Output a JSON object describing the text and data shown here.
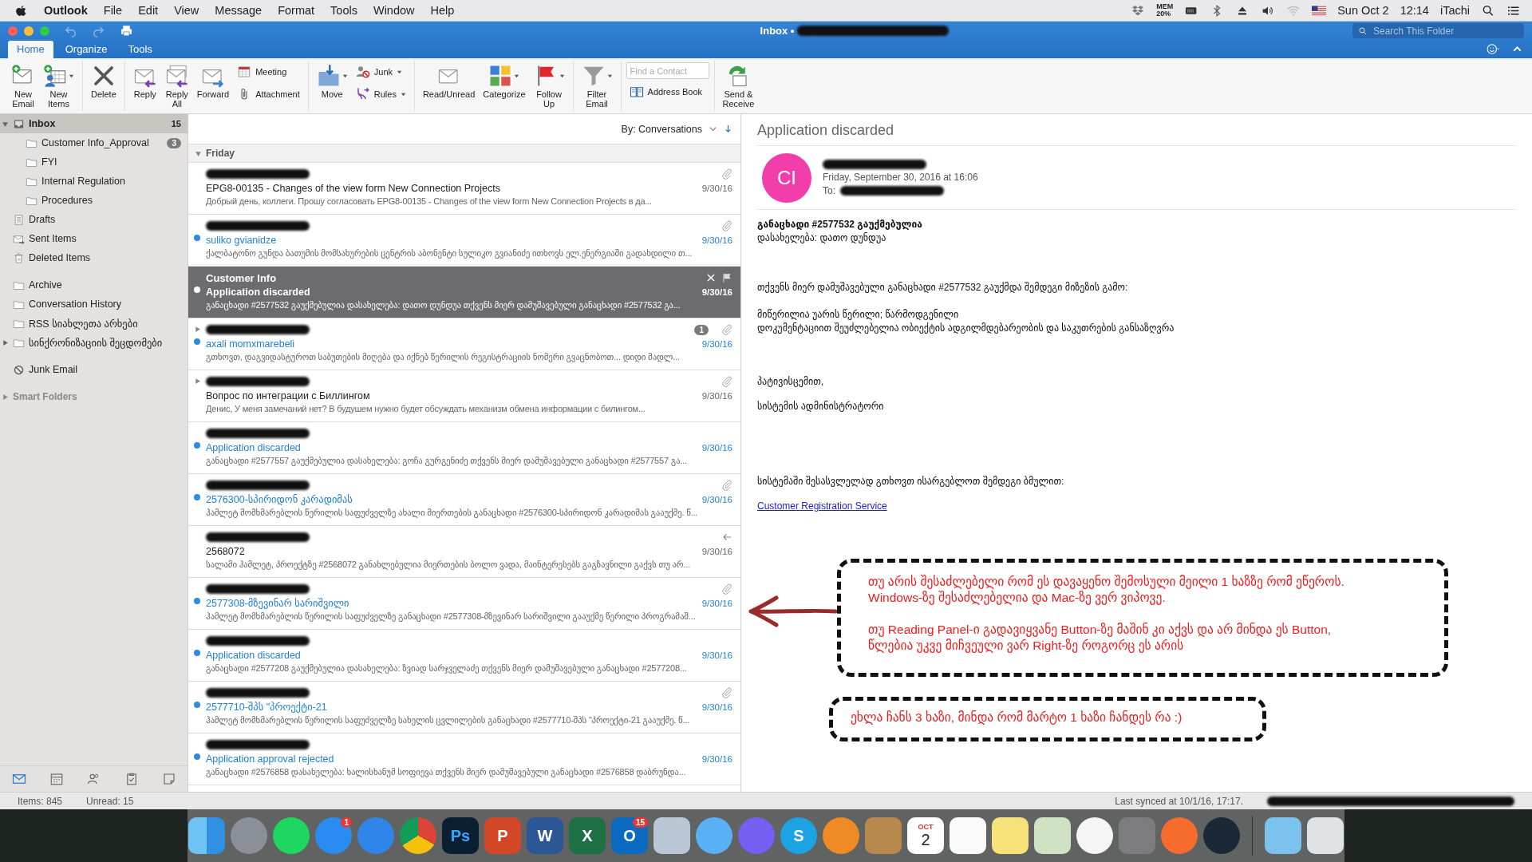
{
  "menubar": {
    "menus": [
      {
        "label": "Outlook",
        "kind": "app"
      },
      {
        "label": "File",
        "kind": "menu"
      },
      {
        "label": "Edit",
        "kind": "menu"
      },
      {
        "label": "View",
        "kind": "menu"
      },
      {
        "label": "Message",
        "kind": "menu"
      },
      {
        "label": "Format",
        "kind": "menu"
      },
      {
        "label": "Tools",
        "kind": "menu"
      },
      {
        "label": "Window",
        "kind": "menu"
      },
      {
        "label": "Help",
        "kind": "menu"
      }
    ],
    "mem_label": "MEM",
    "mem_value": "20%",
    "date": "Sun Oct 2",
    "time": "12:14",
    "user": "iTachi"
  },
  "window": {
    "title": "Inbox •",
    "account_redacted": true,
    "search": {
      "placeholder": "Search This Folder"
    }
  },
  "tabs": [
    {
      "label": "Home",
      "selected": true
    },
    {
      "label": "Organize",
      "selected": false
    },
    {
      "label": "Tools",
      "selected": false
    }
  ],
  "ribbon": {
    "groups": [
      {
        "items": [
          {
            "kind": "new-email",
            "lines": [
              "New",
              "Email"
            ],
            "dropdown": false
          },
          {
            "kind": "new-items",
            "lines": [
              "New",
              "Items"
            ],
            "dropdown": true
          }
        ]
      },
      {
        "items": [
          {
            "kind": "delete",
            "lines": [
              "Delete"
            ],
            "dropdown": false
          }
        ]
      },
      {
        "items": [
          {
            "kind": "reply",
            "lines": [
              "Reply"
            ],
            "dropdown": false
          },
          {
            "kind": "reply-all",
            "lines": [
              "Reply",
              "All"
            ],
            "dropdown": false
          },
          {
            "kind": "forward",
            "lines": [
              "Forward"
            ],
            "dropdown": false
          },
          {
            "stack": [
              {
                "kind": "meeting",
                "label": "Meeting",
                "dropdown": false
              },
              {
                "kind": "attachment",
                "label": "Attachment",
                "dropdown": false
              }
            ]
          }
        ]
      },
      {
        "items": [
          {
            "kind": "move",
            "lines": [
              "Move"
            ],
            "dropdown": true
          },
          {
            "stack": [
              {
                "kind": "junk",
                "label": "Junk",
                "dropdown": true
              },
              {
                "kind": "rules",
                "label": "Rules",
                "dropdown": true
              }
            ]
          }
        ]
      },
      {
        "items": [
          {
            "kind": "read",
            "lines": [
              "Read/Unread"
            ],
            "dropdown": false
          },
          {
            "kind": "categorize",
            "lines": [
              "Categorize"
            ],
            "dropdown": true
          },
          {
            "kind": "flag",
            "lines": [
              "Follow",
              "Up"
            ],
            "dropdown": true
          }
        ]
      },
      {
        "items": [
          {
            "kind": "filter",
            "lines": [
              "Filter",
              "Email"
            ],
            "dropdown": true
          }
        ]
      },
      {
        "items": [
          {
            "stack": [
              {
                "kind": "field",
                "placeholder": "Find a Contact"
              },
              {
                "kind": "address-book",
                "label": "Address Book",
                "dropdown": false
              }
            ]
          }
        ]
      },
      {
        "items": [
          {
            "kind": "send-receive",
            "lines": [
              "Send &",
              "Receive"
            ],
            "dropdown": false
          }
        ]
      }
    ]
  },
  "sidebar": {
    "groups": [
      [
        {
          "label": "Inbox",
          "kind": "inbox",
          "count": "15",
          "selected": true,
          "expanded": true,
          "children": [
            {
              "label": "Customer Info_Approval",
              "kind": "folder",
              "badge": "3",
              "selected": false
            },
            {
              "label": "FYI",
              "kind": "folder",
              "selected": false
            },
            {
              "label": "Internal Regulation",
              "kind": "folder",
              "selected": false
            },
            {
              "label": "Procedures",
              "kind": "folder",
              "selected": false
            }
          ]
        },
        {
          "label": "Drafts",
          "kind": "drafts",
          "selected": false
        },
        {
          "label": "Sent Items",
          "kind": "sent",
          "selected": false
        },
        {
          "label": "Deleted Items",
          "kind": "deleted",
          "selected": false
        }
      ],
      [
        {
          "label": "Archive",
          "kind": "folder",
          "selected": false
        },
        {
          "label": "Conversation History",
          "kind": "folder",
          "selected": false
        },
        {
          "label": "RSS სიახლეთა არხები",
          "kind": "folder",
          "selected": false
        },
        {
          "label": "სინქრონიზაციის შეცდომები",
          "kind": "folder",
          "selected": false,
          "expanded": false
        }
      ],
      [
        {
          "label": "Junk Email",
          "kind": "junk",
          "selected": false
        }
      ]
    ],
    "smart_folders": {
      "label": "Smart Folders",
      "expanded": false
    },
    "nav": [
      {
        "kind": "mail",
        "selected": true
      },
      {
        "kind": "calendar",
        "selected": false
      },
      {
        "kind": "people",
        "selected": false
      },
      {
        "kind": "tasks",
        "selected": false
      },
      {
        "kind": "notes",
        "selected": false
      }
    ]
  },
  "message_list": {
    "sort_label": "By: Conversations",
    "group": {
      "label": "Friday",
      "expanded": true
    },
    "rows": [
      {
        "sender_redacted": true,
        "subject": "EPG8-00135 - Changes of the view form New Connection Projects",
        "date": "9/30/16",
        "preview": "Добрый день, коллеги. Прошу согласовать EPG8-00135 - Changes of the view form New Connection Projects в да...",
        "unread": false,
        "selected": false,
        "attachment": true,
        "thread": false,
        "replied": false
      },
      {
        "sender_redacted": true,
        "subject": "suliko gvianidze",
        "date": "9/30/16",
        "preview": "ქალბატონო გუნდა ბათუმის მომსახურების ცენტრის აბონენტი სულიკო გვიანიძე ითხოვს ელ.ენერგიაში გადახდილი თ...",
        "unread": true,
        "selected": false,
        "attachment": true,
        "thread": false,
        "replied": false
      },
      {
        "sender": "Customer Info",
        "subject": "Application discarded",
        "date": "9/30/16",
        "preview": "განაცხადი #2577532 გაუქმებულია დასახელება: დათო დუნდუა თქვენს მიერ დამუშავებული განაცხადი #2577532 გა...",
        "unread": true,
        "selected": true,
        "attachment": false,
        "thread": false,
        "replied": false
      },
      {
        "sender_redacted": true,
        "subject": "axali momxmarebeli",
        "date": "9/30/16",
        "preview": "გთხოვთ, დაგვიდასტუროთ საბუთების მიღება და იქნებ წერილის რეგისტრაციის ნომერი გვაცნობოთ... დიდი მადლ...",
        "unread": true,
        "selected": false,
        "attachment": true,
        "thread": true,
        "badge": "1",
        "replied": false
      },
      {
        "sender_redacted": true,
        "subject": "Вопрос по интеграции с Биллингом",
        "date": "9/30/16",
        "preview": "Денис, У меня замечаний нет? В будушем нужно будет обсуждать механизм обмена информации с билингом...",
        "unread": false,
        "selected": false,
        "attachment": true,
        "thread": true,
        "replied": false
      },
      {
        "sender_redacted": true,
        "subject": "Application discarded",
        "date": "9/30/16",
        "preview": "განაცხადი #2577557 გაუქმებულია დასახელება: გოჩა გურგენიძე თქვენს მიერ დამუშავებული განაცხადი #2577557 გა...",
        "unread": true,
        "selected": false,
        "attachment": false,
        "thread": false,
        "replied": false
      },
      {
        "sender_redacted": true,
        "subject": "2576300-სპირიდონ კარადიმას",
        "date": "9/30/16",
        "preview": "ჰამლეტ მომხმარებლის წერილის საფუძველზე ახალი მიერთების განაცხადი #2576300-სპირიდონ კარადიმას გააუქმე. წ...",
        "unread": true,
        "selected": false,
        "attachment": true,
        "thread": false,
        "replied": false
      },
      {
        "sender_redacted": true,
        "subject": "2568072",
        "date": "9/30/16",
        "preview": "სალამი ჰამლეტ, პროექტზე #2568072 განახლებულია მიერთების ბოლო ვადა, მაინტერესებს გაგზავნილი გაქვს თუ არ...",
        "unread": false,
        "selected": false,
        "attachment": false,
        "thread": false,
        "replied": true
      },
      {
        "sender_redacted": true,
        "subject": "2577308-მზევინარ სარიშვილი",
        "date": "9/30/16",
        "preview": "ჰამლეტ მომხმარებლის წერილის საფუძველზე განაცხადი #2577308-მზევინარ სარიშვილი გააუქმე წერილი პროგრამაშ...",
        "unread": true,
        "selected": false,
        "attachment": true,
        "thread": false,
        "replied": false
      },
      {
        "sender_redacted": true,
        "subject": "Application discarded",
        "date": "9/30/16",
        "preview": "განაცხადი #2577208 გაუქმებულია დასახელება: ზვიად სარჯველაძე თქვენს მიერ დამუშავებული განაცხადი #2577208...",
        "unread": true,
        "selected": false,
        "attachment": false,
        "thread": false,
        "replied": false
      },
      {
        "sender_redacted": true,
        "subject": "2577710-შპს \"პროექტი-21",
        "date": "9/30/16",
        "preview": "ჰამლეტ მომხმარებლის წერილის საფუძველზე სახელის ცვლილების განაცხადი #2577710-შპს \"პროექტი-21 გააუქმე. წ...",
        "unread": true,
        "selected": false,
        "attachment": true,
        "thread": false,
        "replied": false
      },
      {
        "sender_redacted": true,
        "subject": "Application approval rejected",
        "date": "9/30/16",
        "preview": "განაცხადი #2576858 დასახელება: ხალისხანუმ სოფიევა თქვენს მიერ დამუშავებული განაცხადი #2576858 დაბრუნდა...",
        "unread": true,
        "selected": false,
        "attachment": false,
        "thread": false,
        "replied": false
      }
    ]
  },
  "reading_pane": {
    "subject": "Application discarded",
    "avatar": "CI",
    "sender_redacted": true,
    "date": "Friday, September 30, 2016 at 16:06",
    "to_label": "To:",
    "to_redacted": true,
    "body": [
      {
        "kind": "bold",
        "text": "განაცხადი #2577532 გაუქმებულია"
      },
      {
        "kind": "plain",
        "text": "დასახელება: დათო დუნდუა"
      },
      {
        "kind": "plain",
        "text": "თქვენს მიერ დამუშავებული განაცხადი #2577532 გაუქმდა შემდეგი მიზეზის გამო:"
      },
      {
        "kind": "plain",
        "text": "მიწერილია უარის წერილი; წარმოდგენილი"
      },
      {
        "kind": "plain",
        "text": "დოკუმენტაციით შეუძლებელია ობიექტის ადგილმდებარეობის და საკუთრების განსაზღვრა"
      },
      {
        "kind": "plain",
        "text": "პატივისცემით,"
      },
      {
        "kind": "plain",
        "text": "სისტემის ადმინისტრატორი"
      },
      {
        "kind": "plain",
        "text": "სისტემაში შესასვლელად გთხოვთ ისარგებლოთ შემდეგი ბმულით:"
      },
      {
        "kind": "link",
        "text": "Customer Registration Service"
      }
    ]
  },
  "annotations": [
    {
      "paragraphs": [
        [
          "თუ არის შესაძლებელი რომ ეს დავაყენო შემოსული მეილი 1 ხაზზე რომ ეწეროს.",
          "Windows-ზე შესაძლებელია და Mac-ზე ვერ ვიპოვე."
        ],
        [
          "თუ Reading Panel-ი გადავიყვანე Button-ზე მაშინ კი აქვს და არ მინდა ეს Button,",
          "წლებია უკვე მიჩვეული ვარ Right-ზე როგორც ეს არის"
        ]
      ]
    },
    {
      "paragraphs": [
        [
          "ეხლა ჩანს 3 ხაზი, მინდა რომ მარტო 1 ხაზი ჩანდეს რა :)"
        ]
      ]
    }
  ],
  "status_bar": {
    "items": "Items: 845",
    "unread": "Unread: 15",
    "synced": "Last synced at 10/1/16, 17:17.",
    "account_redacted": true
  },
  "dock": [
    {
      "kind": "finder"
    },
    {
      "kind": "launchpad"
    },
    {
      "kind": "spotify"
    },
    {
      "kind": "appstore",
      "badge": "1"
    },
    {
      "kind": "safari"
    },
    {
      "kind": "chrome"
    },
    {
      "kind": "photoshop",
      "label": "Ps"
    },
    {
      "kind": "powerpoint",
      "label": "P"
    },
    {
      "kind": "word",
      "label": "W"
    },
    {
      "kind": "excel",
      "label": "X"
    },
    {
      "kind": "outlook",
      "label": "O",
      "badge": "15"
    },
    {
      "kind": "preview"
    },
    {
      "kind": "messages"
    },
    {
      "kind": "viber"
    },
    {
      "kind": "skype",
      "label": "S"
    },
    {
      "kind": "books"
    },
    {
      "kind": "contacts"
    },
    {
      "kind": "calendar",
      "month": "OCT",
      "day": "2"
    },
    {
      "kind": "reminders"
    },
    {
      "kind": "notes"
    },
    {
      "kind": "maps"
    },
    {
      "kind": "itunes"
    },
    {
      "kind": "settings"
    },
    {
      "kind": "origin"
    },
    {
      "kind": "steam"
    },
    {
      "kind": "divider"
    },
    {
      "kind": "downloads"
    },
    {
      "kind": "trash"
    }
  ]
}
